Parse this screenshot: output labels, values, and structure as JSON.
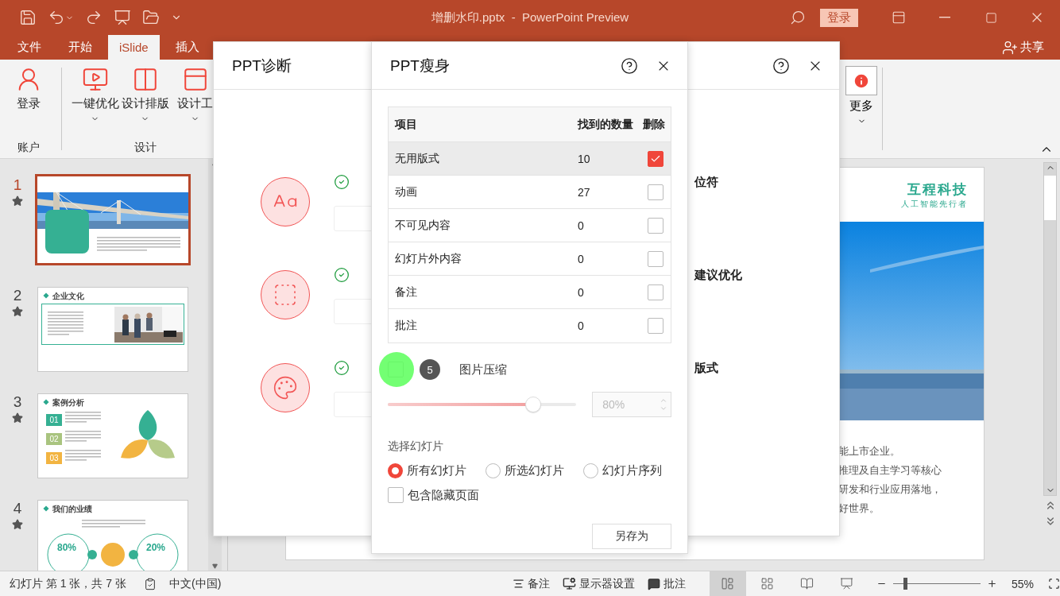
{
  "titlebar": {
    "title": "增删水印.pptx  -  PowerPoint Preview",
    "login": "登录"
  },
  "tabs": [
    {
      "label": "文件",
      "selected": false
    },
    {
      "label": "开始",
      "selected": false
    },
    {
      "label": "iSlide",
      "selected": true
    },
    {
      "label": "插入",
      "selected": false
    }
  ],
  "share": "共享",
  "ribbon": {
    "groups": [
      {
        "label": "账户",
        "buttons": [
          {
            "label": "登录",
            "dropdown": false
          }
        ]
      },
      {
        "label": "设计",
        "buttons": [
          {
            "label": "一键优化",
            "dropdown": true
          },
          {
            "label": "设计排版",
            "dropdown": true
          },
          {
            "label": "设计工",
            "dropdown": true
          }
        ]
      }
    ],
    "more": {
      "label": "更多",
      "dropdown": true
    }
  },
  "slides": [
    {
      "number": "1",
      "selected": true,
      "kind": "cover"
    },
    {
      "number": "2",
      "selected": false,
      "kind": "culture",
      "title": "企业文化"
    },
    {
      "number": "3",
      "selected": false,
      "kind": "cases",
      "title": "案例分析",
      "badges": [
        "01",
        "02",
        "03"
      ]
    },
    {
      "number": "4",
      "selected": false,
      "kind": "results",
      "title": "我们的业绩",
      "stats": [
        "80%",
        "20%"
      ]
    }
  ],
  "editor": {
    "logo": "互程科技",
    "slogan": "人工智能先行者",
    "lines": [
      "能上市企业。",
      "推理及自主学习等核心",
      "研发和行业应用落地，",
      "好世界。"
    ]
  },
  "diagnosis": {
    "title": "PPT诊断",
    "items": [
      {
        "label": "位符"
      },
      {
        "label": "建议优化"
      },
      {
        "label": "版式"
      }
    ]
  },
  "slimming": {
    "title": "PPT瘦身",
    "columns": [
      "项目",
      "找到的数量",
      "删除"
    ],
    "rows": [
      {
        "item": "无用版式",
        "count": "10",
        "checked": true,
        "selected": true
      },
      {
        "item": "动画",
        "count": "27",
        "checked": false,
        "selected": false
      },
      {
        "item": "不可见内容",
        "count": "0",
        "checked": false,
        "selected": false
      },
      {
        "item": "幻灯片外内容",
        "count": "0",
        "checked": false,
        "selected": false
      },
      {
        "item": "备注",
        "count": "0",
        "checked": false,
        "selected": false
      },
      {
        "item": "批注",
        "count": "0",
        "checked": false,
        "selected": false
      }
    ],
    "compress": {
      "label": "图片压缩",
      "checked": false,
      "step_marker": "5"
    },
    "quality": {
      "level": 0.77,
      "value": "80%",
      "disabled": true
    },
    "scope_label": "选择幻灯片",
    "scopes": [
      {
        "label": "所有幻灯片",
        "selected": true
      },
      {
        "label": "所选幻灯片",
        "selected": false
      },
      {
        "label": "幻灯片序列",
        "selected": false
      }
    ],
    "include_hidden": {
      "label": "包含隐藏页面",
      "checked": false
    },
    "save_button": "另存为"
  },
  "status_bar": {
    "slide_info": "幻灯片 第 1 张，共 7 张",
    "language": "中文(中国)",
    "notes": "备注",
    "display": "显示器设置",
    "comments": "批注",
    "views": [
      {
        "selected": true
      },
      {
        "selected": false
      },
      {
        "selected": false
      },
      {
        "selected": false
      }
    ],
    "zoom": {
      "level": 0.14,
      "value": "55%"
    }
  }
}
